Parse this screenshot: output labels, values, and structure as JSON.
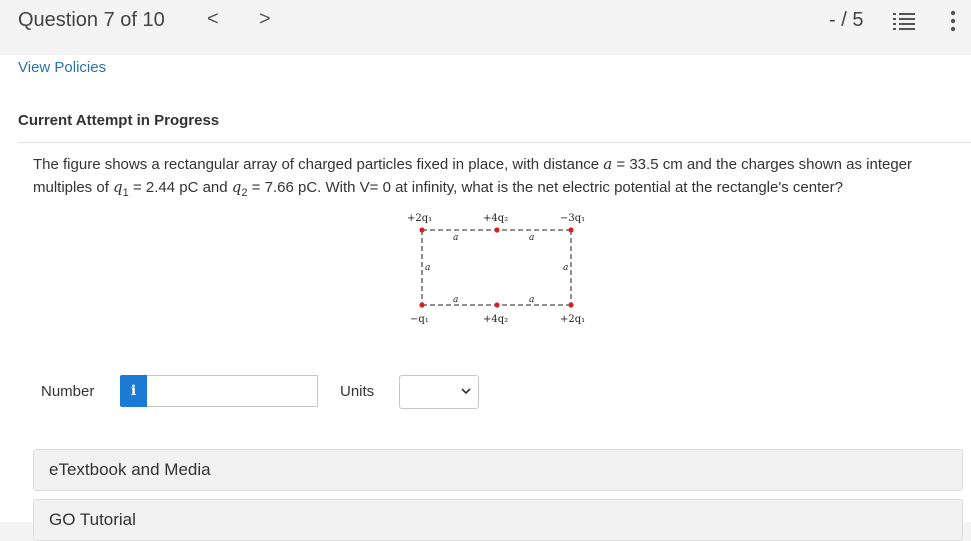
{
  "header": {
    "question_label": "Question 7 of 10",
    "prev_glyph": "<",
    "next_glyph": ">",
    "score": "- / 5"
  },
  "links": {
    "view_policies": "View Policies"
  },
  "attempt_status": "Current Attempt in Progress",
  "question": {
    "part1": "The figure shows a rectangular array of charged particles fixed in place, with distance ",
    "var_a": "a",
    "part2": " = 33.5 cm and the charges shown as integer multiples of ",
    "q1_sym": "q",
    "q1_sub": "1",
    "part3": " = 2.44 pC and ",
    "q2_sym": "q",
    "q2_sub": "2",
    "part4": " = 7.66 pC. With V= 0 at infinity, what is the net electric potential at the rectangle's center?"
  },
  "figure": {
    "labels": {
      "top_left": "+2q₁",
      "top_mid": "+4q₂",
      "top_right": "−3q₁",
      "bottom_left": "−q₁",
      "bottom_mid": "+4q₂",
      "bottom_right": "+2q₁",
      "distance": "a"
    },
    "dot_color": "#d62020"
  },
  "answer": {
    "number_label": "Number",
    "info_glyph": "i",
    "input_value": "",
    "units_label": "Units",
    "units_selected": ""
  },
  "resources": [
    {
      "label": "eTextbook and Media"
    },
    {
      "label": "GO Tutorial"
    }
  ],
  "colors": {
    "link": "#2a73a8",
    "info_button": "#1a7ad4"
  }
}
